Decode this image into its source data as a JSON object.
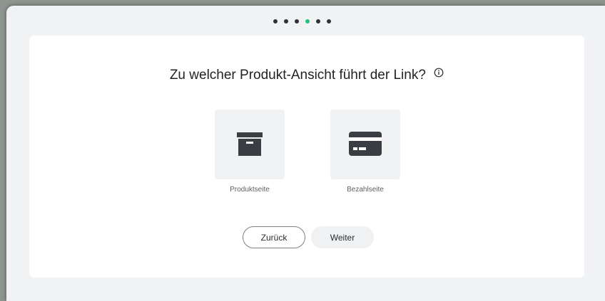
{
  "progress": {
    "total_steps": 6,
    "current_step": 4,
    "colors": {
      "active": "#1ec47a",
      "inactive": "#2f3236"
    }
  },
  "question": {
    "text": "Zu welcher Produkt-Ansicht führt der Link?",
    "info_icon": "info-circle-icon"
  },
  "options": [
    {
      "label": "Produktseite",
      "icon": "archive-box-icon"
    },
    {
      "label": "Bezahlseite",
      "icon": "credit-card-icon"
    }
  ],
  "buttons": {
    "back_label": "Zurück",
    "next_label": "Weiter"
  }
}
